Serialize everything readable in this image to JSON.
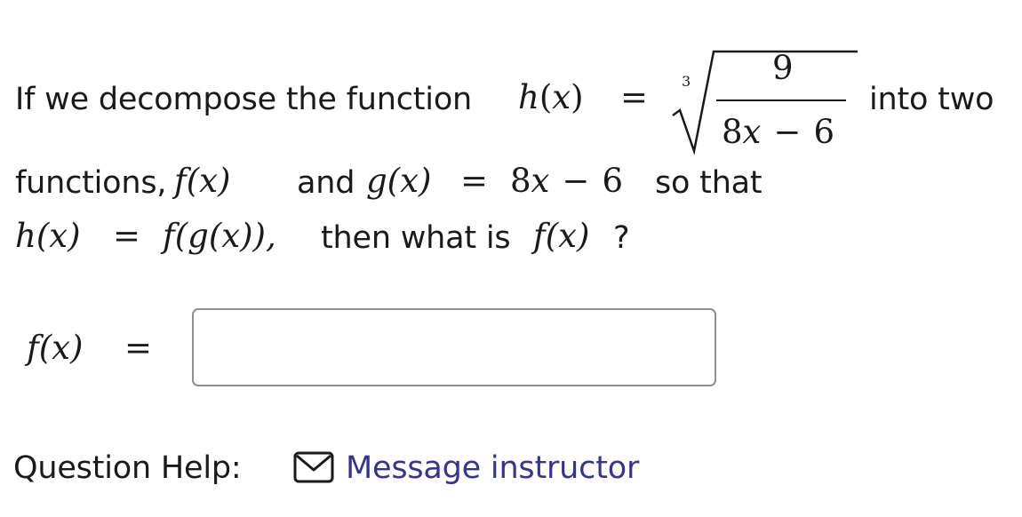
{
  "question": {
    "line1": {
      "prefix": "If we decompose the function",
      "h_name": "h",
      "h_arg": "x",
      "equals": "=",
      "root_index": "3",
      "numerator": "9",
      "denominator_coef": "8",
      "denominator_var": "x",
      "minus": "−",
      "denominator_const": "6",
      "suffix": "into two"
    },
    "line2": {
      "prefix": "functions,",
      "f_expr": "f(x)",
      "and_word": "and",
      "g_expr": "g(x)",
      "equals": "=",
      "rhs_coef": "8",
      "rhs_var": "x",
      "minus": "−",
      "rhs_const": "6",
      "suffix": "so that"
    },
    "line3": {
      "h_expr": "h(x)",
      "equals": "=",
      "composition": "f(g(x)),",
      "middle": "then what is",
      "f_expr": "f(x)",
      "end": "?"
    }
  },
  "answer": {
    "label": "f(x)",
    "equals": "=",
    "value": "",
    "placeholder": ""
  },
  "help": {
    "label": "Question Help:",
    "icon": "envelope-icon",
    "link_text": "Message instructor",
    "link_color": "#343494"
  }
}
